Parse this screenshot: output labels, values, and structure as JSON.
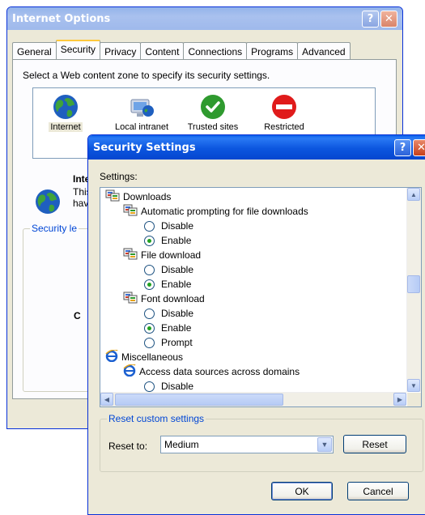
{
  "back_window": {
    "title": "Internet Options",
    "help_button": "?",
    "close_button": "✕",
    "tabs": [
      "General",
      "Security",
      "Privacy",
      "Content",
      "Connections",
      "Programs",
      "Advanced"
    ],
    "selected_tab": "Security",
    "zone_prompt": "Select a Web content zone to specify its security settings.",
    "zones": [
      {
        "label": "Internet",
        "icon": "globe-icon"
      },
      {
        "label": "Local intranet",
        "icon": "computer-globe-icon"
      },
      {
        "label": "Trusted sites",
        "icon": "checkmark-icon"
      },
      {
        "label": "Restricted",
        "icon": "no-entry-icon"
      }
    ],
    "info_title": "Inte",
    "info_line1": "This",
    "info_line2": "have",
    "security_level_label": "Security le",
    "security_level_value": "C"
  },
  "front_window": {
    "title": "Security Settings",
    "help_button": "?",
    "close_button": "✕",
    "settings_label": "Settings:",
    "tree": [
      {
        "type": "category",
        "label": "Downloads",
        "icon": "settings-category-icon"
      },
      {
        "type": "setting",
        "label": "Automatic prompting for file downloads",
        "icon": "settings-category-icon"
      },
      {
        "type": "option",
        "label": "Disable",
        "checked": false
      },
      {
        "type": "option",
        "label": "Enable",
        "checked": true
      },
      {
        "type": "setting",
        "label": "File download",
        "icon": "settings-category-icon"
      },
      {
        "type": "option",
        "label": "Disable",
        "checked": false
      },
      {
        "type": "option",
        "label": "Enable",
        "checked": true
      },
      {
        "type": "setting",
        "label": "Font download",
        "icon": "settings-category-icon"
      },
      {
        "type": "option",
        "label": "Disable",
        "checked": false
      },
      {
        "type": "option",
        "label": "Enable",
        "checked": true
      },
      {
        "type": "option",
        "label": "Prompt",
        "checked": false
      },
      {
        "type": "category",
        "label": "Miscellaneous",
        "icon": "ie-icon"
      },
      {
        "type": "setting",
        "label": "Access data sources across domains",
        "icon": "ie-icon"
      },
      {
        "type": "option",
        "label": "Disable",
        "checked": false
      }
    ],
    "scroll_up": "▲",
    "scroll_down": "▼",
    "scroll_left": "◀",
    "scroll_right": "▶",
    "reset_group_label": "Reset custom settings",
    "reset_to_label": "Reset to:",
    "reset_to_value": "Medium",
    "reset_button": "Reset",
    "ok_button": "OK",
    "cancel_button": "Cancel"
  },
  "colors": {
    "titlebar_active": "#0a5fe8",
    "titlebar_inactive": "#9fb9ec",
    "dialog_bg": "#ece9d8",
    "group_label": "#0046d5",
    "radio_dot": "#21a121"
  }
}
